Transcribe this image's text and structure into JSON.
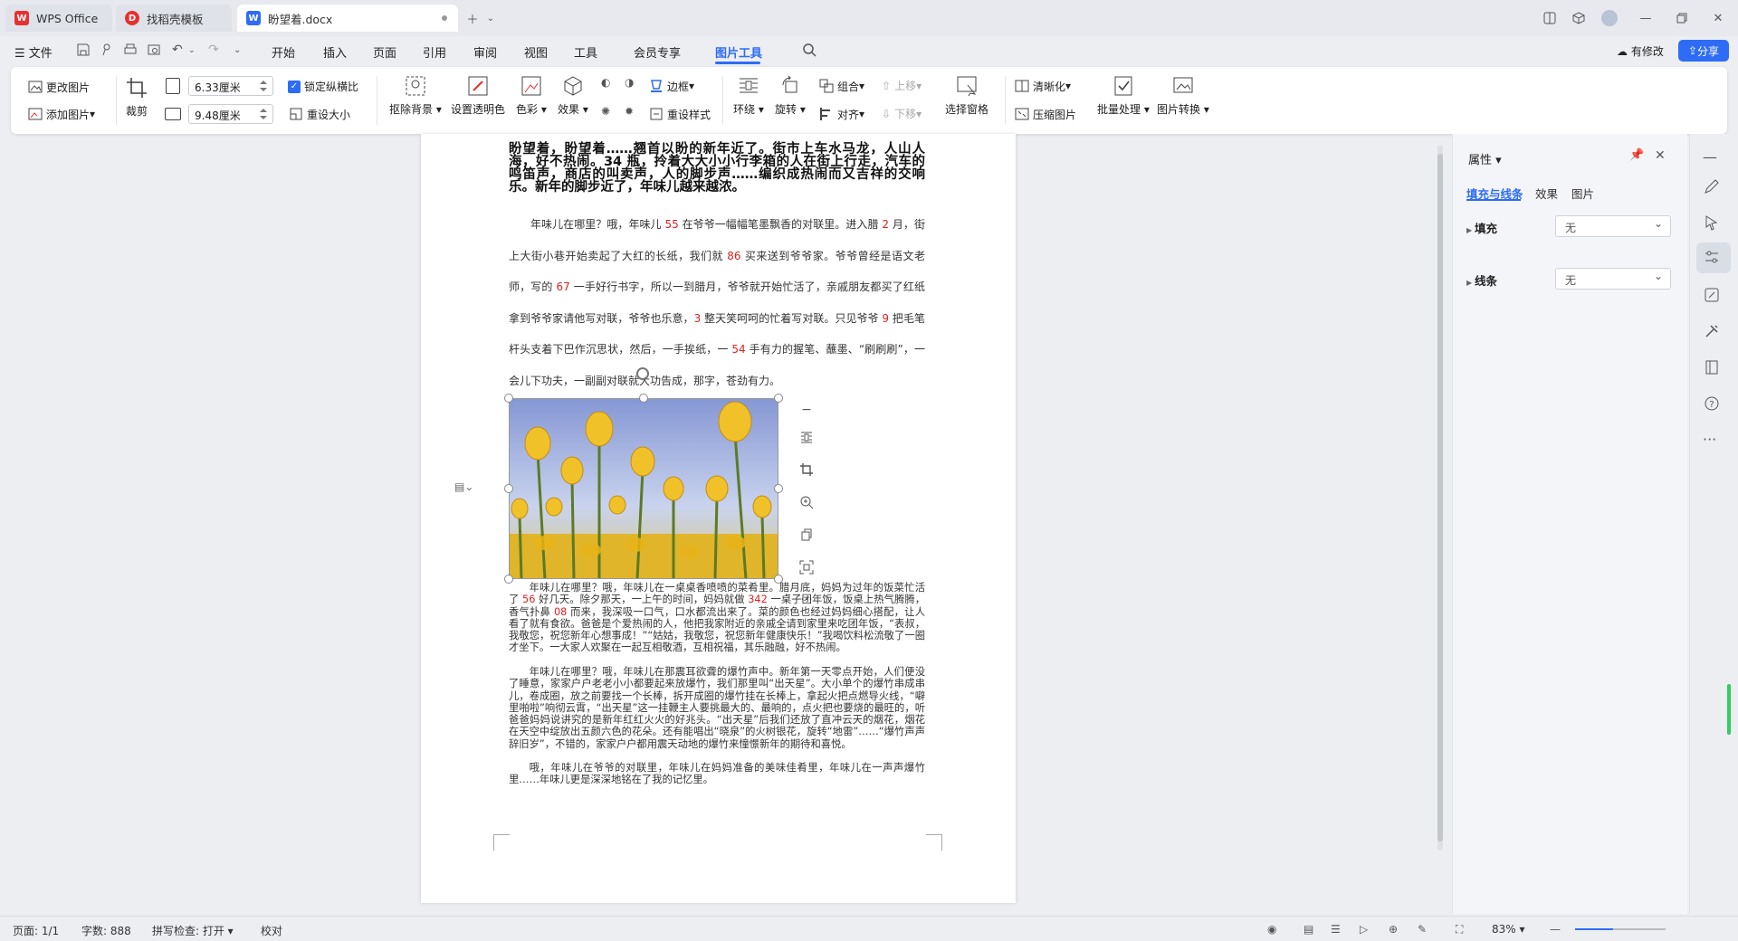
{
  "tabs": [
    {
      "label": "WPS Office"
    },
    {
      "label": "找稻壳模板"
    },
    {
      "label": "盼望着.docx"
    }
  ],
  "menu": {
    "file": "文件",
    "items": [
      "开始",
      "插入",
      "页面",
      "引用",
      "审阅",
      "视图",
      "工具",
      "会员专享",
      "图片工具"
    ],
    "active": "图片工具",
    "has_changes": "有修改",
    "share": "分享"
  },
  "ribbon": {
    "change_pic": "更改图片",
    "add_pic": "添加图片",
    "crop": "裁剪",
    "width": "6.33厘米",
    "height": "9.48厘米",
    "lock_ratio": "锁定纵横比",
    "reset_size": "重设大小",
    "remove_bg": "抠除背景",
    "set_transparent": "设置透明色",
    "color": "色彩",
    "effect": "效果",
    "border": "边框",
    "reset_style": "重设样式",
    "wrap": "环绕",
    "rotate": "旋转",
    "group": "组合",
    "align": "对齐",
    "move_up": "上移",
    "move_down": "下移",
    "selection_pane": "选择窗格",
    "clarity": "清晰化",
    "compress": "压缩图片",
    "batch": "批量处理",
    "convert": "图片转换"
  },
  "document": {
    "heading": "盼望着，盼望着……翘首以盼的新年近了。街市上车水马龙，人山人海，好不热闹。34 瓶，拎着大大小小行李箱的人在街上行走，汽车的鸣笛声，商店的叫卖声，人的脚步声……编织成热闹而又吉祥的交响乐。新年的脚步近了，年味儿越来越浓。",
    "p1": [
      {
        "t": "年味儿在哪里？哦，年味儿 "
      },
      {
        "n": "55"
      },
      {
        "t": " 在爷爷一幅幅笔墨飘香的对联里。进入腊 "
      },
      {
        "n": "2"
      },
      {
        "t": " 月，街上大街小巷开始卖起了大红的长纸，我们就 "
      },
      {
        "n": "86"
      },
      {
        "t": " 买来送到爷爷家。爷爷曾经是语文老师，写的 "
      },
      {
        "n": "67"
      },
      {
        "t": " 一手好行书字，所以一到腊月，爷爷就开始忙活了，亲戚朋友都买了红纸拿到爷爷家请他写对联，爷爷也乐意，"
      },
      {
        "n": "3"
      },
      {
        "t": " 整天笑呵呵的忙着写对联。只见爷爷 "
      },
      {
        "n": "9"
      },
      {
        "t": " 把毛笔杆头支着下巴作沉思状，然后，一手挨纸，一 "
      },
      {
        "n": "54"
      },
      {
        "t": " 手有力的握笔、蘸墨、“刷刷刷”，一会儿下功夫，一副副对联就大功告成，那字，苍劲有力。"
      }
    ],
    "p2": [
      {
        "t": "年味儿在哪里？哦，年味儿在一桌桌香喷喷的菜肴里。腊月底，妈妈为过年的饭菜忙活了 "
      },
      {
        "n": "56"
      },
      {
        "t": " 好几天。除夕那天，一上午的时间，妈妈就做 "
      },
      {
        "n": "342"
      },
      {
        "t": " 一桌子团年饭，饭桌上热气腾腾，香气扑鼻 "
      },
      {
        "n": "08"
      },
      {
        "t": " 而来，我深吸一口气，口水都流出来了。菜的颜色也经过妈妈细心搭配，让人看了就有食欲。爸爸是个爱热闹的人，他把我家附近的亲戚全请到家里来吃团年饭，“表叔，我敬您，祝您新年心想事成！”“姑姑，我敬您，祝您新年健康快乐！”我喝饮料松流敬了一圈才坐下。一大家人欢聚在一起互相敬酒，互相祝福，其乐融融，好不热闹。"
      }
    ],
    "p3": "年味儿在哪里？哦，年味儿在那震耳欲聋的爆竹声中。新年第一天零点开始，人们便没了睡意，家家户户老老小小都要起来放爆竹，我们那里叫“出天星”。大小单个的爆竹串成串儿，卷成圈，放之前要找一个长棒，拆开成圈的爆竹挂在长棒上，拿起火把点燃导火线，“噼里啪啦”响彻云霄，“出天星”这一挂鞭主人要挑最大的、最响的，点火把也要烧的最旺的，听爸爸妈妈说讲究的是新年红红火火的好兆头。“出天星”后我们还放了直冲云天的烟花，烟花在天空中绽放出五颜六色的花朵。还有能唱出“晓泉”的火树银花，旋转“地雷”……“爆竹声声辞旧岁”，不错的，家家户户都用震天动地的爆竹来憧憬新年的期待和喜悦。",
    "p4": "哦，年味儿在爷爷的对联里，年味儿在妈妈准备的美味佳肴里，年味儿在一声声爆竹里……年味儿更是深深地铭在了我的记忆里。"
  },
  "properties": {
    "title": "属性",
    "tabs": [
      "填充与线条",
      "效果",
      "图片"
    ],
    "fill_label": "填充",
    "fill_value": "无",
    "line_label": "线条",
    "line_value": "无"
  },
  "status": {
    "page": "页面: 1/1",
    "words": "字数: 888",
    "spell": "拼写检查: 打开",
    "proof": "校对",
    "zoom": "83%"
  },
  "colors": {
    "accent": "#2e6cf6",
    "number_red": "#d22222",
    "wps_red": "#e8302f"
  }
}
